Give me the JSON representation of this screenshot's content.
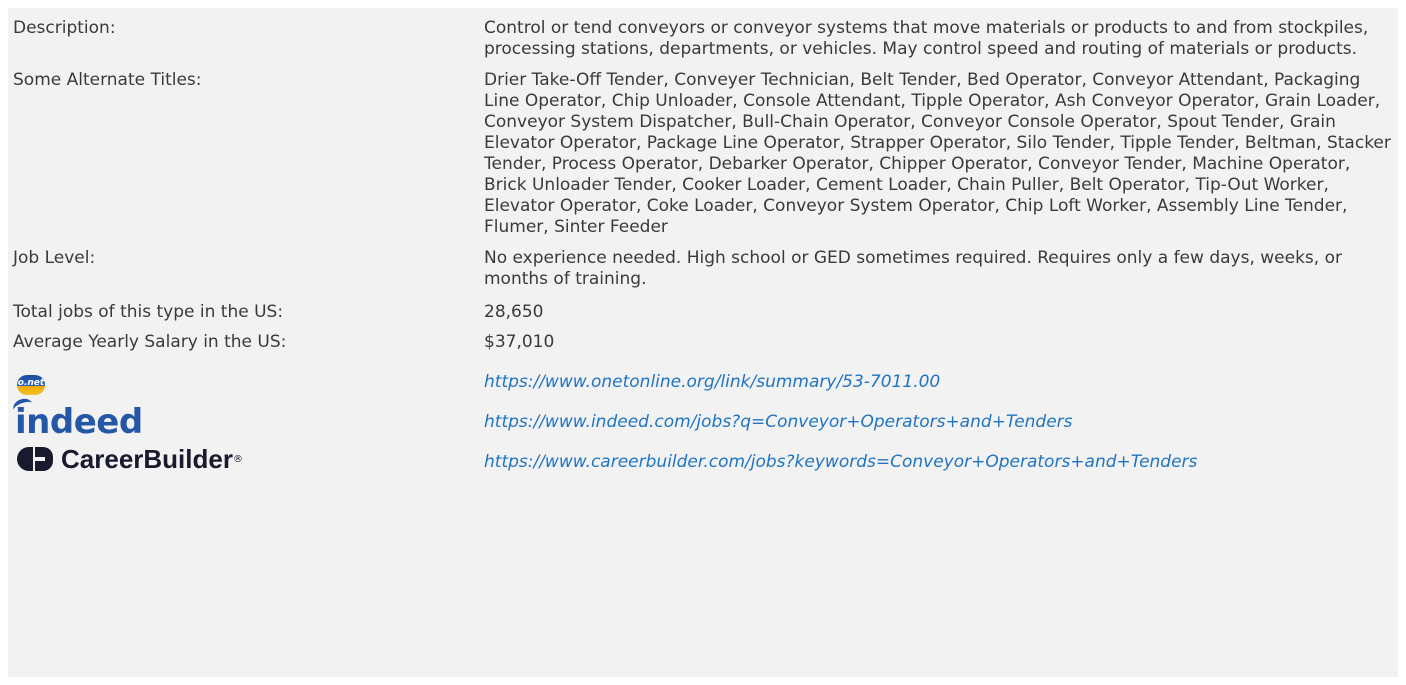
{
  "rows": {
    "description": {
      "label": "Description:",
      "value": "Control or tend conveyors or conveyor systems that move materials or products to and from stockpiles, processing stations, departments, or vehicles. May control speed and routing of materials or products."
    },
    "alternate_titles": {
      "label": "Some Alternate Titles:",
      "value": "Drier Take-Off Tender, Conveyer Technician, Belt Tender, Bed Operator, Conveyor Attendant, Packaging Line Operator, Chip Unloader, Console Attendant, Tipple Operator, Ash Conveyor Operator, Grain Loader, Conveyor System Dispatcher, Bull-Chain Operator, Conveyor Console Operator, Spout Tender, Grain Elevator Operator, Package Line Operator, Strapper Operator, Silo Tender, Tipple Tender, Beltman, Stacker Tender, Process Operator, Debarker Operator, Chipper Operator, Conveyor Tender, Machine Operator, Brick Unloader Tender, Cooker Loader, Cement Loader, Chain Puller, Belt Operator, Tip-Out Worker, Elevator Operator, Coke Loader, Conveyor System Operator, Chip Loft Worker, Assembly Line Tender, Flumer, Sinter Feeder"
    },
    "job_level": {
      "label": "Job Level:",
      "value": "No experience needed. High school or GED sometimes required. Requires only a few days, weeks, or months of training."
    },
    "total_jobs": {
      "label": "Total jobs of this type in the US:",
      "value": "28,650"
    },
    "salary": {
      "label": "Average Yearly Salary in the US:",
      "value": "$37,010"
    }
  },
  "links": {
    "onet": {
      "logo_text": "o.net",
      "icon": "onet-logo-icon",
      "url": "https://www.onetonline.org/link/summary/53-7011.00"
    },
    "indeed": {
      "logo_text": "indeed",
      "icon": "indeed-logo-icon",
      "url": "https://www.indeed.com/jobs?q=Conveyor+Operators+and+Tenders"
    },
    "careerbuilder": {
      "logo_text": "CareerBuilder",
      "logo_reg": "®",
      "icon": "careerbuilder-logo-icon",
      "url": "https://www.careerbuilder.com/jobs?keywords=Conveyor+Operators+and+Tenders"
    }
  },
  "colors": {
    "background": "#f2f2f2",
    "text": "#3a3a3a",
    "link": "#1f74c4",
    "indeed_blue": "#2557a7"
  }
}
